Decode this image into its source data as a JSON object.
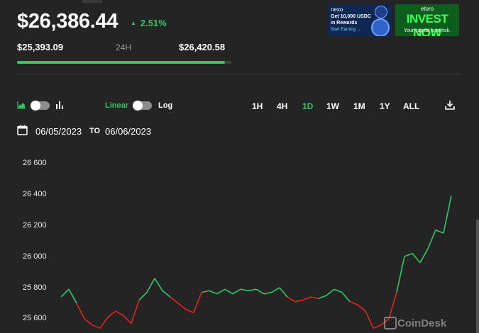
{
  "summary": {
    "price": "$26,386.44",
    "change": "2.51%",
    "low": "$25,393.09",
    "range_label": "24H",
    "high": "$26,420.58",
    "range_progress": 0.97
  },
  "ads": {
    "nexo": {
      "brand": "nexo",
      "line1": "Get 10,000 USDC",
      "line2": "in Rewards",
      "cta": "Start Earning →"
    },
    "etoro": {
      "brand": "etoro",
      "headline": "INVEST NOW",
      "disclaimer": "Your capital is at risk."
    }
  },
  "controls": {
    "scale_linear": "Linear",
    "scale_log": "Log",
    "timeframes": [
      "1H",
      "4H",
      "1D",
      "1W",
      "1M",
      "1Y",
      "ALL"
    ],
    "active_timeframe": "1D",
    "date_from": "06/05/2023",
    "date_to_label": "TO",
    "date_to": "06/06/2023"
  },
  "colors": {
    "up": "#2ec866",
    "down": "#e8221b",
    "background": "#242424"
  },
  "icons": {
    "area-chart": "area-chart-icon",
    "bar-chart": "bar-chart-icon",
    "calendar": "calendar-icon",
    "download": "download-icon"
  },
  "watermark": "CoinDesk",
  "chart_data": {
    "type": "line",
    "yticks": [
      "26 600",
      "26 400",
      "26 200",
      "26 000",
      "25 800",
      "25 600"
    ],
    "ylim": [
      25560,
      26670
    ],
    "x": [
      0,
      0.02,
      0.04,
      0.06,
      0.08,
      0.1,
      0.12,
      0.14,
      0.16,
      0.18,
      0.2,
      0.22,
      0.24,
      0.26,
      0.28,
      0.3,
      0.32,
      0.34,
      0.36,
      0.38,
      0.4,
      0.42,
      0.44,
      0.46,
      0.48,
      0.5,
      0.52,
      0.54,
      0.56,
      0.58,
      0.6,
      0.62,
      0.64,
      0.66,
      0.68,
      0.7,
      0.72,
      0.74,
      0.76,
      0.78,
      0.8,
      0.82,
      0.84,
      0.86,
      0.88,
      0.9,
      0.92,
      0.94,
      0.96,
      0.98,
      1.0
    ],
    "values": [
      25740,
      25790,
      25700,
      25600,
      25560,
      25540,
      25610,
      25650,
      25620,
      25570,
      25720,
      25770,
      25860,
      25780,
      25740,
      25700,
      25660,
      25640,
      25770,
      25780,
      25760,
      25790,
      25760,
      25790,
      25780,
      25790,
      25760,
      25770,
      25800,
      25740,
      25710,
      25720,
      25740,
      25730,
      25750,
      25790,
      25770,
      25710,
      25690,
      25650,
      25540,
      25560,
      25600,
      25770,
      26000,
      26020,
      25960,
      26050,
      26170,
      26150,
      26390
    ]
  }
}
